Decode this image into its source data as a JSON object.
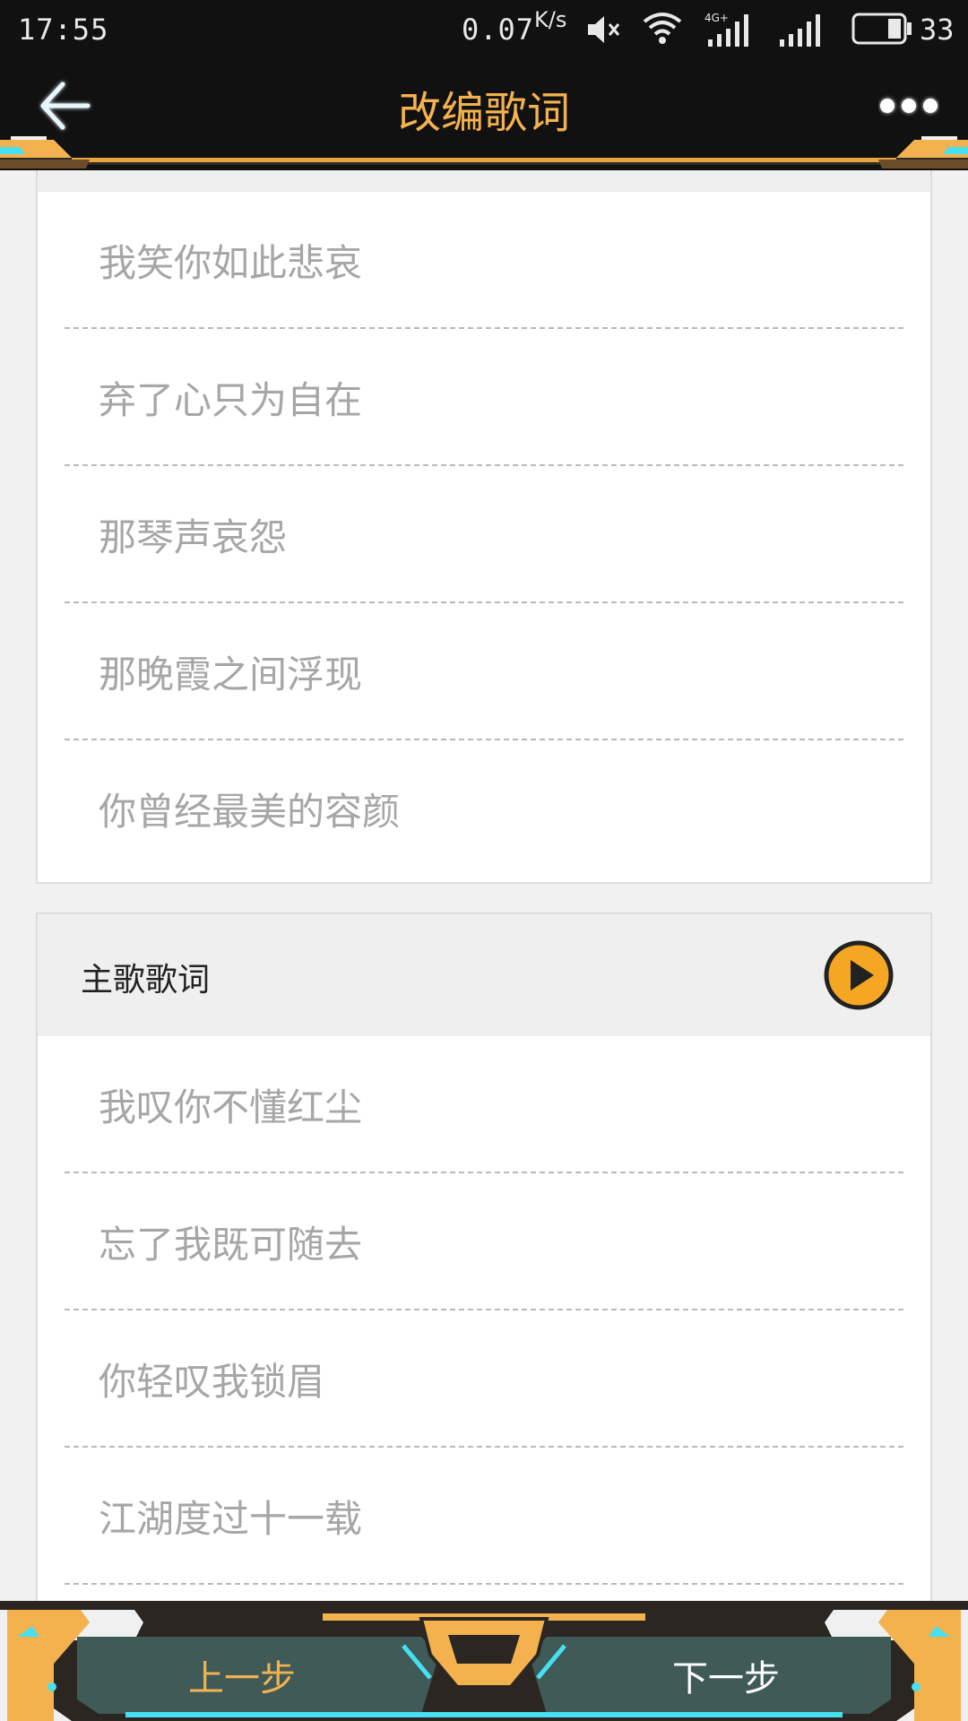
{
  "status_bar": {
    "time": "17:55",
    "net_speed": "0.07",
    "net_unit": "K/s",
    "battery": "33",
    "icons": [
      "mute-icon",
      "wifi-icon",
      "signal-4g-icon",
      "signal-icon",
      "battery-icon"
    ]
  },
  "header": {
    "title": "改编歌词",
    "back_icon": "back-arrow-icon",
    "more_icon": "more-dots-icon"
  },
  "section_1": {
    "lines": [
      "我笑你如此悲哀",
      "弃了心只为自在",
      "那琴声哀怨",
      "那晚霞之间浮现",
      "你曾经最美的容颜"
    ]
  },
  "section_2": {
    "title": "主歌歌词",
    "play_icon": "play-icon",
    "lines": [
      "我叹你不懂红尘",
      "忘了我既可随去",
      "你轻叹我锁眉",
      "江湖度过十一载"
    ]
  },
  "footer": {
    "prev_label": "上一步",
    "next_label": "下一步"
  },
  "colors": {
    "accent": "#f4b24f",
    "header_bg": "#111111",
    "lyric_text": "#a6a6a6",
    "bottom_bar": "#3f5a57",
    "cyan": "#46e0f0"
  }
}
